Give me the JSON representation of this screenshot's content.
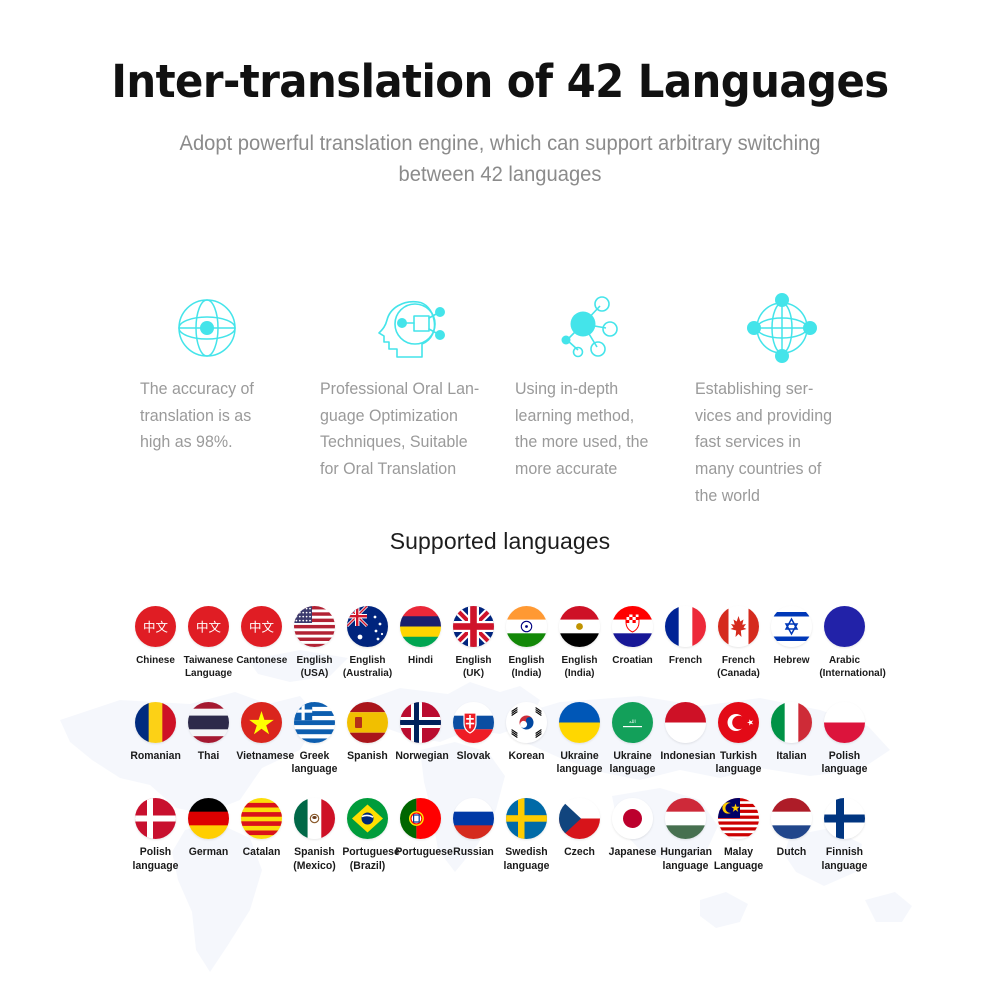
{
  "header": {
    "title": "Inter-translation of 42 Languages",
    "subtitle": "Adopt powerful translation engine, which can support arbitrary switching between 42 languages"
  },
  "accent_color": "#44e4ea",
  "text_color": "#9a9a9a",
  "features": [
    {
      "icon": "globe-meridian-icon",
      "text": "The accuracy of\ntranslation is as\nhigh as 98%."
    },
    {
      "icon": "ai-head-icon",
      "text": "Professional Oral Lan-\nguage Optimization\nTechniques, Suitable\nfor Oral Translation"
    },
    {
      "icon": "neural-network-icon",
      "text": "Using in-depth\nlearning method,\nthe more used, the\nmore accurate"
    },
    {
      "icon": "global-network-icon",
      "text": "Establishing ser-\nvices and providing\nfast services in\nmany countries of\nthe world"
    }
  ],
  "supported_heading": "Supported languages",
  "flag_rows": [
    [
      {
        "label": "Chinese",
        "flag": "cn-text"
      },
      {
        "label": "Taiwanese\nLanguage",
        "flag": "cn-text"
      },
      {
        "label": "Cantonese",
        "flag": "cn-text"
      },
      {
        "label": "English\n(USA)",
        "flag": "us"
      },
      {
        "label": "English\n(Australia)",
        "flag": "au"
      },
      {
        "label": "Hindi",
        "flag": "mu"
      },
      {
        "label": "English\n(UK)",
        "flag": "gb"
      },
      {
        "label": "English\n(India)",
        "flag": "in"
      },
      {
        "label": "English\n(India)",
        "flag": "eg"
      },
      {
        "label": "Croatian",
        "flag": "hr"
      },
      {
        "label": "French",
        "flag": "fr"
      },
      {
        "label": "French\n(Canada)",
        "flag": "ca"
      },
      {
        "label": "Hebrew",
        "flag": "il"
      },
      {
        "label": "Arabic\n(International)",
        "flag": "arabic-blue"
      }
    ],
    [
      {
        "label": "Romanian",
        "flag": "ro"
      },
      {
        "label": "Thai",
        "flag": "th"
      },
      {
        "label": "Vietnamese",
        "flag": "vn"
      },
      {
        "label": "Greek\nlanguage",
        "flag": "gr"
      },
      {
        "label": "Spanish",
        "flag": "es"
      },
      {
        "label": "Norwegian",
        "flag": "no"
      },
      {
        "label": "Slovak",
        "flag": "sk"
      },
      {
        "label": "Korean",
        "flag": "kr"
      },
      {
        "label": "Ukraine\nlanguage",
        "flag": "ua"
      },
      {
        "label": "Ukraine\nlanguage",
        "flag": "sa"
      },
      {
        "label": "Indonesian",
        "flag": "id"
      },
      {
        "label": "Turkish\nlanguage",
        "flag": "tr"
      },
      {
        "label": "Italian",
        "flag": "it"
      },
      {
        "label": "Polish\nlanguage",
        "flag": "pl"
      }
    ],
    [
      {
        "label": "Polish\nlanguage",
        "flag": "dk"
      },
      {
        "label": "German",
        "flag": "de"
      },
      {
        "label": "Catalan",
        "flag": "cat"
      },
      {
        "label": "Spanish\n(Mexico)",
        "flag": "mx"
      },
      {
        "label": "Portuguese\n(Brazil)",
        "flag": "br"
      },
      {
        "label": "Portuguese",
        "flag": "pt"
      },
      {
        "label": "Russian",
        "flag": "ru"
      },
      {
        "label": "Swedish\nlanguage",
        "flag": "se"
      },
      {
        "label": "Czech",
        "flag": "cz"
      },
      {
        "label": "Japanese",
        "flag": "jp"
      },
      {
        "label": "Hungarian\nlanguage",
        "flag": "hu"
      },
      {
        "label": "Malay\nLanguage",
        "flag": "my"
      },
      {
        "label": "Dutch",
        "flag": "nl"
      },
      {
        "label": "Finnish\nlanguage",
        "flag": "fi"
      }
    ]
  ]
}
